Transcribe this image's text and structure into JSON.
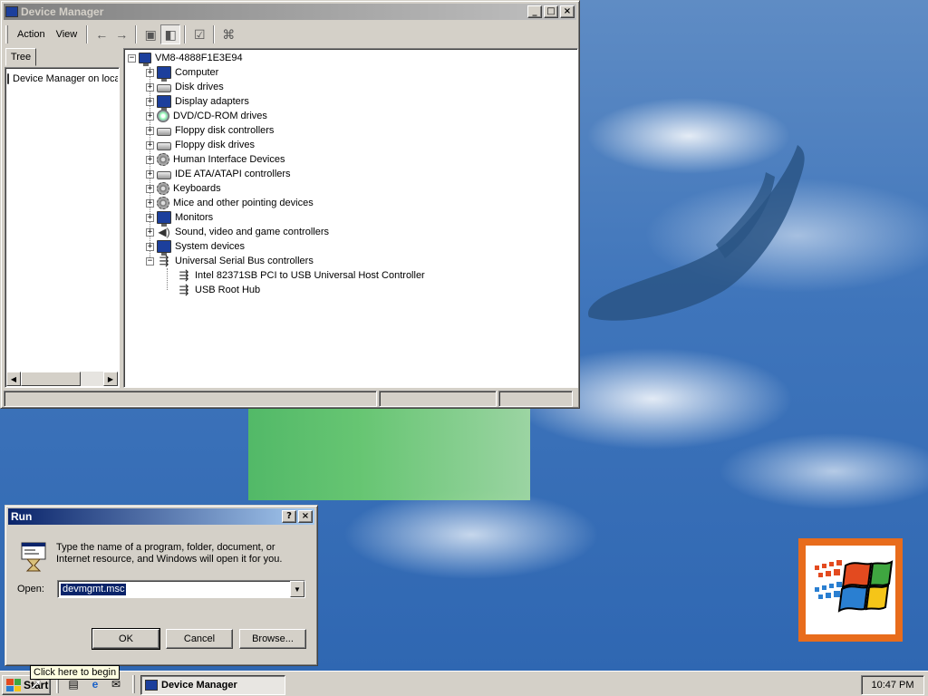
{
  "device_manager": {
    "title": "Device Manager",
    "menu": [
      "Action",
      "View"
    ],
    "left_tab": "Tree",
    "left_item": "Device Manager on local computer",
    "root": "VM8-4888F1E3E94",
    "categories": [
      {
        "label": "Computer",
        "icon": "computer-icon"
      },
      {
        "label": "Disk drives",
        "icon": "disk-drive-icon"
      },
      {
        "label": "Display adapters",
        "icon": "display-adapter-icon"
      },
      {
        "label": "DVD/CD-ROM drives",
        "icon": "cdrom-icon"
      },
      {
        "label": "Floppy disk controllers",
        "icon": "controller-icon"
      },
      {
        "label": "Floppy disk drives",
        "icon": "floppy-icon"
      },
      {
        "label": "Human Interface Devices",
        "icon": "hid-icon"
      },
      {
        "label": "IDE ATA/ATAPI controllers",
        "icon": "ide-icon"
      },
      {
        "label": "Keyboards",
        "icon": "keyboard-icon"
      },
      {
        "label": "Mice and other pointing devices",
        "icon": "mouse-icon"
      },
      {
        "label": "Monitors",
        "icon": "monitor-icon"
      },
      {
        "label": "Sound, video and game controllers",
        "icon": "sound-icon"
      },
      {
        "label": "System devices",
        "icon": "system-icon"
      },
      {
        "label": "Universal Serial Bus controllers",
        "icon": "usb-icon"
      }
    ],
    "usb_children": [
      "Intel 82371SB PCI to USB Universal Host Controller",
      "USB Root Hub"
    ]
  },
  "run_dialog": {
    "title": "Run",
    "help_btn": "?",
    "close_btn": "×",
    "prompt": "Type the name of a program, folder, document, or Internet resource, and Windows will open it for you.",
    "open_label": "Open:",
    "open_value": "devmgmt.msc",
    "ok": "OK",
    "cancel": "Cancel",
    "browse": "Browse..."
  },
  "taskbar": {
    "start_label": "Start",
    "task_label": "Device Manager",
    "clock": "10:47 PM",
    "tooltip": "Click here to begin"
  }
}
